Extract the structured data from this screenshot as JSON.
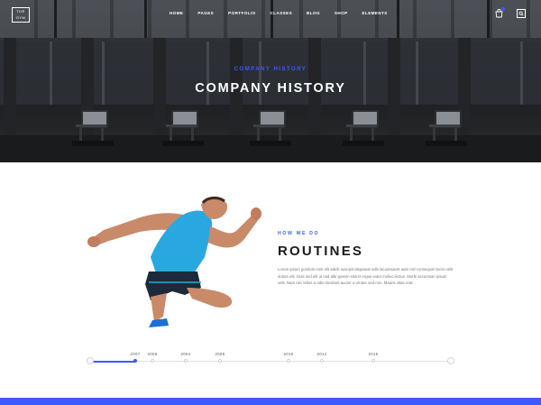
{
  "header": {
    "logo_text": "THE GYM",
    "nav": [
      "HOME",
      "PAGES",
      "PORTFOLIO",
      "CLASSES",
      "BLOG",
      "SHOP",
      "ELEMENTS"
    ]
  },
  "hero": {
    "subtitle": "COMPANY HISTORY",
    "title": "COMPANY HISTORY"
  },
  "content": {
    "eyebrow": "HOW WE DO",
    "title": "ROUTINES",
    "body": "Lorem ipsum gosdolo mnit elit adelit suscipit aliquaeat odle lacuamaent aute nisl consequat sociis velit dolore elit. Duis sed elit ut mid alte gosem sitorct ergue eulet molivo lectus. Morbi accumsan ipsum velit. Nam nec tellus a odio tincidunt auctor a ornare sed non. Mauris vitae erat."
  },
  "timeline": {
    "years": [
      "2007",
      "2008",
      "2004",
      "2005",
      "2010",
      "2012",
      "2015"
    ],
    "active_index": 0
  },
  "colors": {
    "accent": "#3d5afe"
  },
  "icons": [
    "cart-icon",
    "search-icon"
  ]
}
